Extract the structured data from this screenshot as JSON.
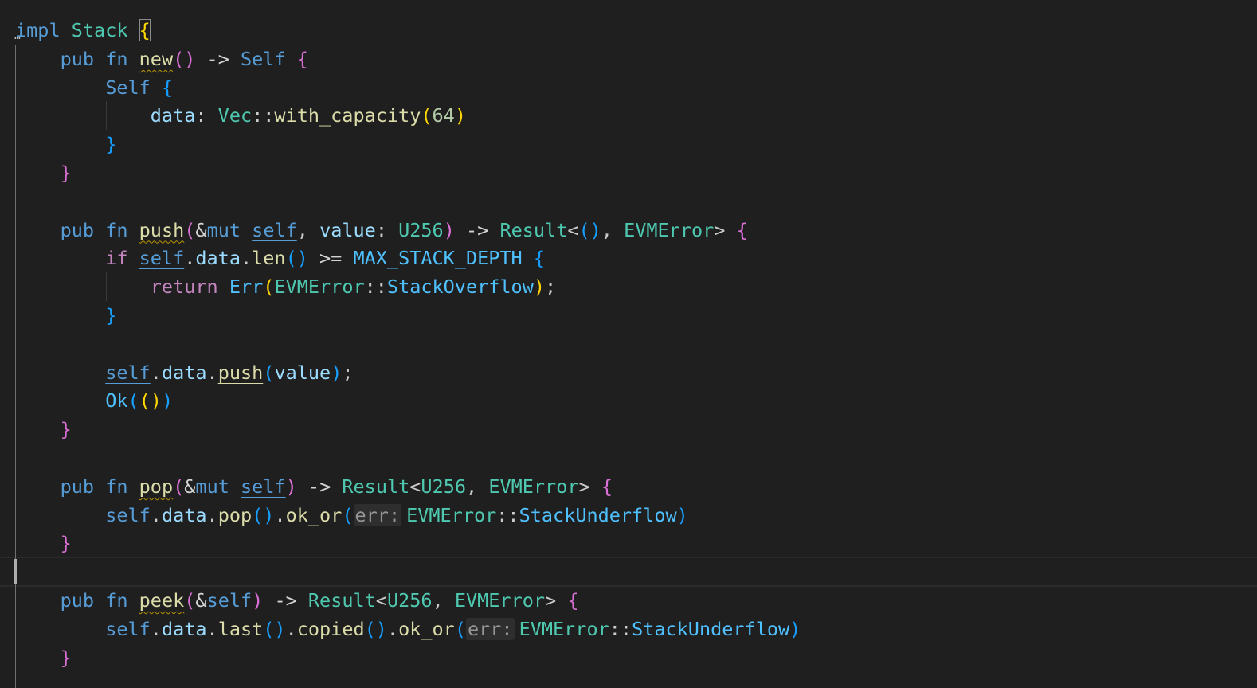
{
  "editor": {
    "language": "rust",
    "theme_colors": {
      "background": "#1f1f1f",
      "keyword": "#569cd6",
      "control": "#c586c0",
      "type": "#4ec9b0",
      "function": "#dcdcaa",
      "variable": "#9cdcfe",
      "enum_member": "#4fc1ff",
      "number": "#b5cea8",
      "bracket_level_1": "#ffd700",
      "bracket_level_2": "#da70d6",
      "bracket_level_3": "#179fff"
    },
    "icons": {
      "fold": "fold-dots-icon"
    },
    "inlay_hints": {
      "err_param": "err:"
    },
    "lines": [
      {
        "tokens": [
          {
            "t": "impl",
            "c": "kw"
          },
          {
            "t": " ",
            "c": "p"
          },
          {
            "t": "Stack",
            "c": "ty"
          },
          {
            "t": " ",
            "c": "p"
          },
          {
            "t": "{",
            "c": "b1 bracket-box"
          }
        ]
      },
      {
        "tokens": [
          {
            "t": "    "
          },
          {
            "t": "pub",
            "c": "kw"
          },
          {
            "t": " "
          },
          {
            "t": "fn",
            "c": "kw"
          },
          {
            "t": " "
          },
          {
            "t": "new",
            "c": "fn sq"
          },
          {
            "t": "()",
            "c": "b2"
          },
          {
            "t": " -> ",
            "c": "op"
          },
          {
            "t": "Self",
            "c": "kw"
          },
          {
            "t": " "
          },
          {
            "t": "{",
            "c": "b2"
          }
        ]
      },
      {
        "tokens": [
          {
            "t": "        "
          },
          {
            "t": "Self",
            "c": "kw"
          },
          {
            "t": " "
          },
          {
            "t": "{",
            "c": "b3"
          }
        ]
      },
      {
        "tokens": [
          {
            "t": "            "
          },
          {
            "t": "data",
            "c": "var"
          },
          {
            "t": ": ",
            "c": "p"
          },
          {
            "t": "Vec",
            "c": "ty"
          },
          {
            "t": "::",
            "c": "p"
          },
          {
            "t": "with_capacity",
            "c": "fn"
          },
          {
            "t": "(",
            "c": "b1"
          },
          {
            "t": "64",
            "c": "num"
          },
          {
            "t": ")",
            "c": "b1"
          }
        ]
      },
      {
        "tokens": [
          {
            "t": "        "
          },
          {
            "t": "}",
            "c": "b3"
          }
        ]
      },
      {
        "tokens": [
          {
            "t": "    "
          },
          {
            "t": "}",
            "c": "b2"
          }
        ]
      },
      {
        "tokens": []
      },
      {
        "tokens": [
          {
            "t": "    "
          },
          {
            "t": "pub",
            "c": "kw"
          },
          {
            "t": " "
          },
          {
            "t": "fn",
            "c": "kw"
          },
          {
            "t": " "
          },
          {
            "t": "push",
            "c": "fn sq"
          },
          {
            "t": "(",
            "c": "b2"
          },
          {
            "t": "&",
            "c": "op"
          },
          {
            "t": "mut",
            "c": "kw"
          },
          {
            "t": " "
          },
          {
            "t": "self",
            "c": "kw ul"
          },
          {
            "t": ", ",
            "c": "p"
          },
          {
            "t": "value",
            "c": "var"
          },
          {
            "t": ": ",
            "c": "p"
          },
          {
            "t": "U256",
            "c": "ty"
          },
          {
            "t": ")",
            "c": "b2"
          },
          {
            "t": " -> ",
            "c": "op"
          },
          {
            "t": "Result",
            "c": "ty"
          },
          {
            "t": "<",
            "c": "p"
          },
          {
            "t": "()",
            "c": "b3"
          },
          {
            "t": ", ",
            "c": "p"
          },
          {
            "t": "EVMError",
            "c": "ty"
          },
          {
            "t": ">",
            "c": "p"
          },
          {
            "t": " "
          },
          {
            "t": "{",
            "c": "b2"
          }
        ]
      },
      {
        "tokens": [
          {
            "t": "        "
          },
          {
            "t": "if",
            "c": "ctl"
          },
          {
            "t": " "
          },
          {
            "t": "self",
            "c": "kw ul"
          },
          {
            "t": ".",
            "c": "p"
          },
          {
            "t": "data",
            "c": "var"
          },
          {
            "t": ".",
            "c": "p"
          },
          {
            "t": "len",
            "c": "fn"
          },
          {
            "t": "()",
            "c": "b3"
          },
          {
            "t": " >= ",
            "c": "op"
          },
          {
            "t": "MAX_STACK_DEPTH",
            "c": "const"
          },
          {
            "t": " "
          },
          {
            "t": "{",
            "c": "b3"
          }
        ]
      },
      {
        "tokens": [
          {
            "t": "            "
          },
          {
            "t": "return",
            "c": "ctl"
          },
          {
            "t": " "
          },
          {
            "t": "Err",
            "c": "enum"
          },
          {
            "t": "(",
            "c": "b1"
          },
          {
            "t": "EVMError",
            "c": "ty"
          },
          {
            "t": "::",
            "c": "p"
          },
          {
            "t": "StackOverflow",
            "c": "enum"
          },
          {
            "t": ")",
            "c": "b1"
          },
          {
            "t": ";",
            "c": "p"
          }
        ]
      },
      {
        "tokens": [
          {
            "t": "        "
          },
          {
            "t": "}",
            "c": "b3"
          }
        ]
      },
      {
        "tokens": []
      },
      {
        "tokens": [
          {
            "t": "        "
          },
          {
            "t": "self",
            "c": "kw ul"
          },
          {
            "t": ".",
            "c": "p"
          },
          {
            "t": "data",
            "c": "var"
          },
          {
            "t": ".",
            "c": "p"
          },
          {
            "t": "push",
            "c": "fn ul"
          },
          {
            "t": "(",
            "c": "b3"
          },
          {
            "t": "value",
            "c": "var"
          },
          {
            "t": ")",
            "c": "b3"
          },
          {
            "t": ";",
            "c": "p"
          }
        ]
      },
      {
        "tokens": [
          {
            "t": "        "
          },
          {
            "t": "Ok",
            "c": "enum"
          },
          {
            "t": "(",
            "c": "b3"
          },
          {
            "t": "()",
            "c": "b1"
          },
          {
            "t": ")",
            "c": "b3"
          }
        ]
      },
      {
        "tokens": [
          {
            "t": "    "
          },
          {
            "t": "}",
            "c": "b2"
          }
        ]
      },
      {
        "tokens": []
      },
      {
        "tokens": [
          {
            "t": "    "
          },
          {
            "t": "pub",
            "c": "kw"
          },
          {
            "t": " "
          },
          {
            "t": "fn",
            "c": "kw"
          },
          {
            "t": " "
          },
          {
            "t": "pop",
            "c": "fn sq"
          },
          {
            "t": "(",
            "c": "b2"
          },
          {
            "t": "&",
            "c": "op"
          },
          {
            "t": "mut",
            "c": "kw"
          },
          {
            "t": " "
          },
          {
            "t": "self",
            "c": "kw ul"
          },
          {
            "t": ")",
            "c": "b2"
          },
          {
            "t": " -> ",
            "c": "op"
          },
          {
            "t": "Result",
            "c": "ty"
          },
          {
            "t": "<",
            "c": "p"
          },
          {
            "t": "U256",
            "c": "ty"
          },
          {
            "t": ", ",
            "c": "p"
          },
          {
            "t": "EVMError",
            "c": "ty"
          },
          {
            "t": ">",
            "c": "p"
          },
          {
            "t": " "
          },
          {
            "t": "{",
            "c": "b2"
          }
        ]
      },
      {
        "tokens": [
          {
            "t": "        "
          },
          {
            "t": "self",
            "c": "kw ul"
          },
          {
            "t": ".",
            "c": "p"
          },
          {
            "t": "data",
            "c": "var"
          },
          {
            "t": ".",
            "c": "p"
          },
          {
            "t": "pop",
            "c": "fn ul"
          },
          {
            "t": "()",
            "c": "b3"
          },
          {
            "t": ".",
            "c": "p"
          },
          {
            "t": "ok_or",
            "c": "fn"
          },
          {
            "t": "(",
            "c": "b3"
          },
          {
            "hint": "err_param"
          },
          {
            "t": "EVMError",
            "c": "ty"
          },
          {
            "t": "::",
            "c": "p"
          },
          {
            "t": "StackUnderflow",
            "c": "enum"
          },
          {
            "t": ")",
            "c": "b3"
          }
        ]
      },
      {
        "tokens": [
          {
            "t": "    "
          },
          {
            "t": "}",
            "c": "b2"
          }
        ]
      },
      {
        "tokens": []
      },
      {
        "tokens": [
          {
            "t": "    "
          },
          {
            "t": "pub",
            "c": "kw"
          },
          {
            "t": " "
          },
          {
            "t": "fn",
            "c": "kw"
          },
          {
            "t": " "
          },
          {
            "t": "peek",
            "c": "fn sq"
          },
          {
            "t": "(",
            "c": "b2"
          },
          {
            "t": "&",
            "c": "op"
          },
          {
            "t": "self",
            "c": "kw"
          },
          {
            "t": ")",
            "c": "b2"
          },
          {
            "t": " -> ",
            "c": "op"
          },
          {
            "t": "Result",
            "c": "ty"
          },
          {
            "t": "<",
            "c": "p"
          },
          {
            "t": "U256",
            "c": "ty"
          },
          {
            "t": ", ",
            "c": "p"
          },
          {
            "t": "EVMError",
            "c": "ty"
          },
          {
            "t": ">",
            "c": "p"
          },
          {
            "t": " "
          },
          {
            "t": "{",
            "c": "b2"
          }
        ]
      },
      {
        "tokens": [
          {
            "t": "        "
          },
          {
            "t": "self",
            "c": "kw"
          },
          {
            "t": ".",
            "c": "p"
          },
          {
            "t": "data",
            "c": "var"
          },
          {
            "t": ".",
            "c": "p"
          },
          {
            "t": "last",
            "c": "fn"
          },
          {
            "t": "()",
            "c": "b3"
          },
          {
            "t": ".",
            "c": "p"
          },
          {
            "t": "copied",
            "c": "fn"
          },
          {
            "t": "()",
            "c": "b3"
          },
          {
            "t": ".",
            "c": "p"
          },
          {
            "t": "ok_or",
            "c": "fn"
          },
          {
            "t": "(",
            "c": "b3"
          },
          {
            "hint": "err_param"
          },
          {
            "t": "EVMError",
            "c": "ty"
          },
          {
            "t": "::",
            "c": "p"
          },
          {
            "t": "StackUnderflow",
            "c": "enum"
          },
          {
            "t": ")",
            "c": "b3"
          }
        ]
      },
      {
        "tokens": [
          {
            "t": "    "
          },
          {
            "t": "}",
            "c": "b2"
          }
        ]
      }
    ]
  }
}
